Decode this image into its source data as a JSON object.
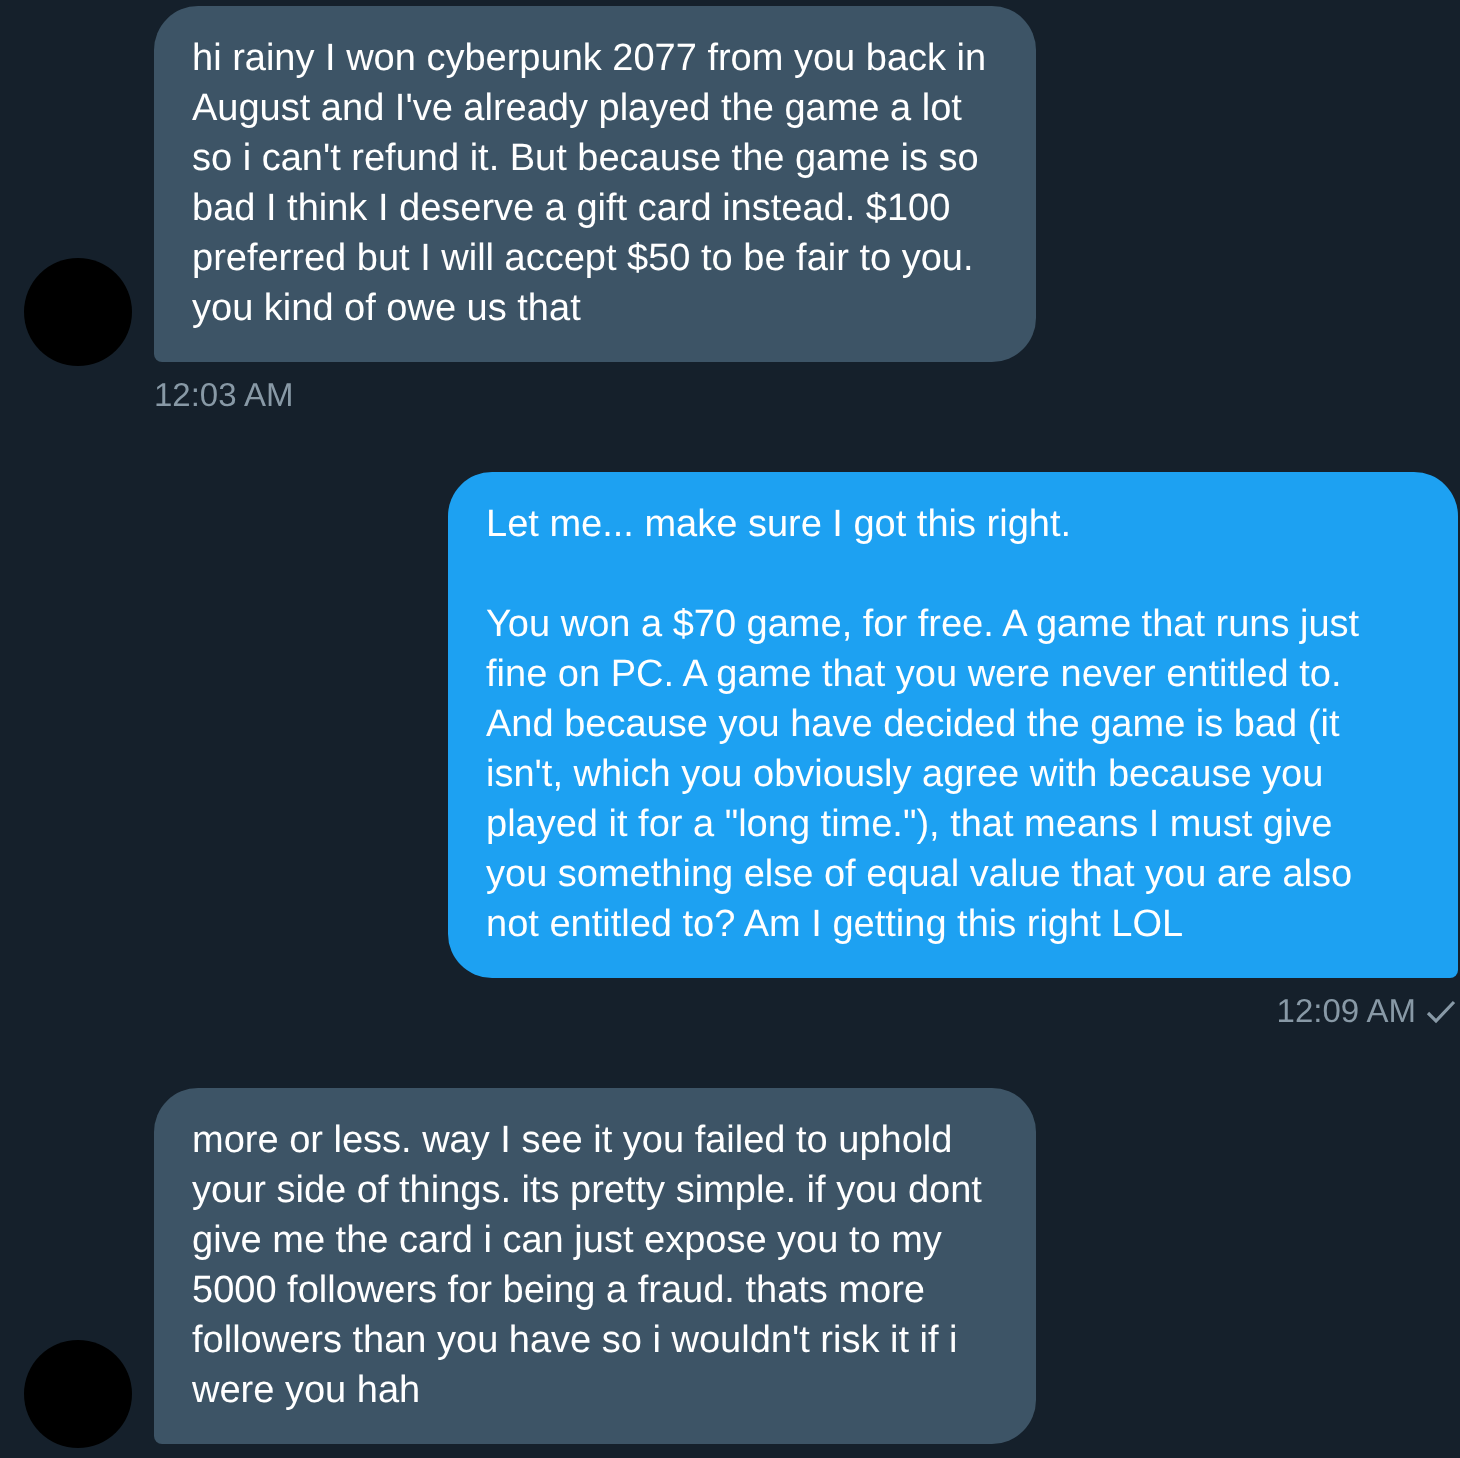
{
  "messages": [
    {
      "kind": "incoming",
      "paragraphs": [
        "hi rainy I won cyberpunk 2077 from you back in August and I've already played the game a lot so i can't refund it. But because the game is so bad I think I deserve a gift card instead. $100 preferred but I will accept $50 to be fair to you. you kind of owe us that"
      ],
      "time": "12:03 AM"
    },
    {
      "kind": "outgoing",
      "paragraphs": [
        "Let me... make sure I got this right.",
        "You won a $70 game, for free. A game that runs just fine on PC. A game that you were never entitled to. And because you have decided the game is bad (it isn't, which you obviously agree with because you played it for a \"long time.\"), that means I must give you something else of equal value that you are also not entitled to? Am I getting this right LOL"
      ],
      "time": "12:09 AM",
      "sent": true
    },
    {
      "kind": "incoming",
      "paragraphs": [
        "more or less. way I see it you failed to uphold your side of things. its pretty simple. if you dont give me the card i can just expose you to my 5000 followers for being a fraud. thats more followers than you have so i wouldn't risk it if i were you hah"
      ]
    }
  ]
}
